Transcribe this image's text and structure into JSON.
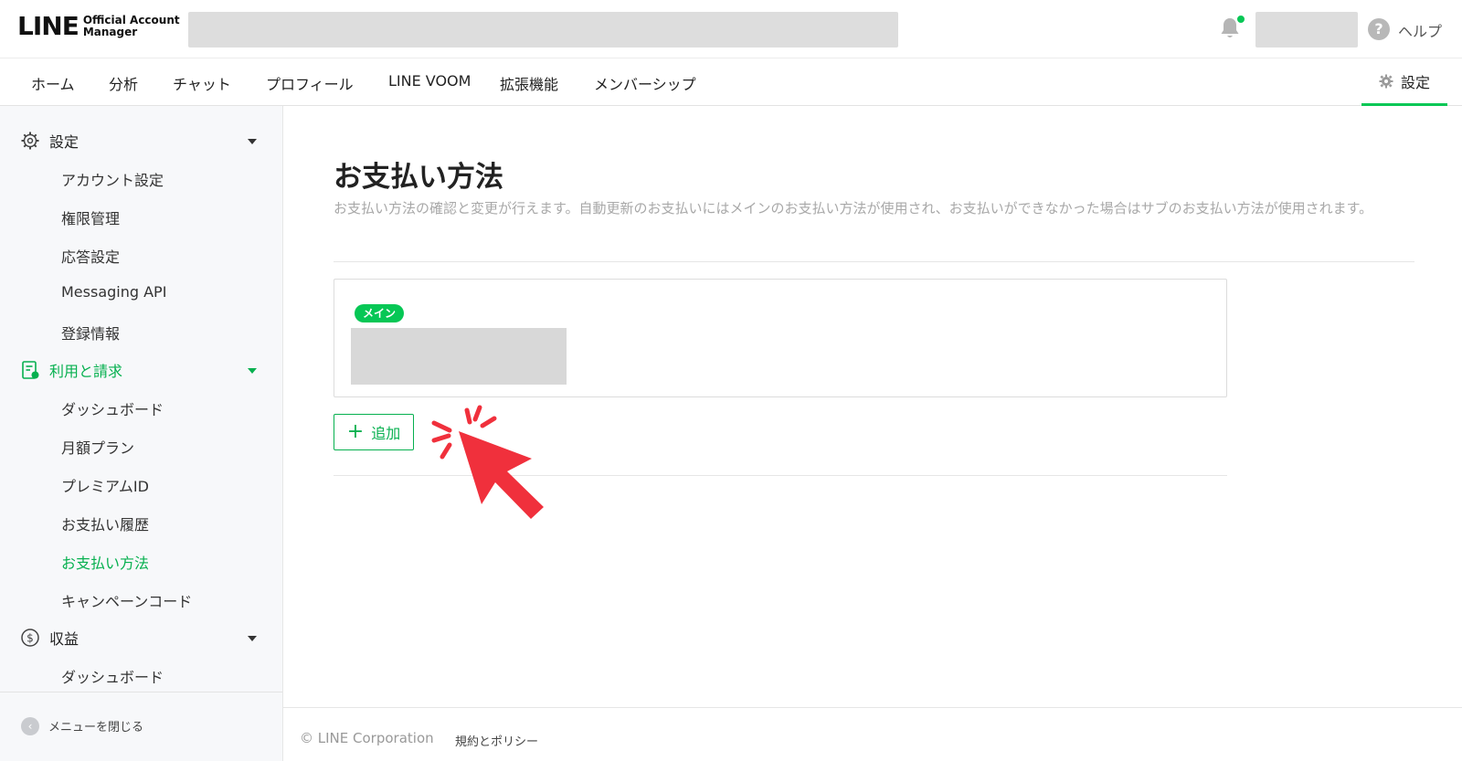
{
  "header": {
    "logo_main": "LINE",
    "logo_sub_line1": "Official Account",
    "logo_sub_line2": "Manager",
    "help_label": "ヘルプ",
    "help_icon": "?"
  },
  "nav": {
    "tabs": [
      {
        "label": "ホーム"
      },
      {
        "label": "分析"
      },
      {
        "label": "チャット"
      },
      {
        "label": "プロフィール"
      },
      {
        "label": "LINE VOOM"
      },
      {
        "label": "拡張機能"
      },
      {
        "label": "メンバーシップ"
      }
    ],
    "settings_label": "設定"
  },
  "sidebar": {
    "groups": [
      {
        "label": "設定",
        "icon": "gear-icon"
      },
      {
        "label": "利用と請求",
        "icon": "invoice-icon"
      },
      {
        "label": "収益",
        "icon": "dollar-icon"
      }
    ],
    "settings_items": [
      {
        "label": "アカウント設定"
      },
      {
        "label": "権限管理"
      },
      {
        "label": "応答設定"
      },
      {
        "label": "Messaging API"
      },
      {
        "label": "登録情報"
      }
    ],
    "billing_items": [
      {
        "label": "ダッシュボード"
      },
      {
        "label": "月額プラン"
      },
      {
        "label": "プレミアムID"
      },
      {
        "label": "お支払い履歴"
      },
      {
        "label": "お支払い方法"
      },
      {
        "label": "キャンペーンコード"
      }
    ],
    "revenue_items": [
      {
        "label": "ダッシュボード"
      }
    ],
    "collapse_label": "メニューを閉じる"
  },
  "main": {
    "title": "お支払い方法",
    "description": "お支払い方法の確認と変更が行えます。自動更新のお支払いにはメインのお支払い方法が使用され、お支払いができなかった場合はサブのお支払い方法が使用されます。",
    "card": {
      "badge": "メイン"
    },
    "add_label": "追加",
    "add_icon": "+"
  },
  "footer": {
    "copyright": "© LINE Corporation",
    "policy": "規約とポリシー"
  },
  "colors": {
    "accent": "#06c755",
    "accent_text": "#06b04f",
    "pointer": "#f0303c"
  }
}
